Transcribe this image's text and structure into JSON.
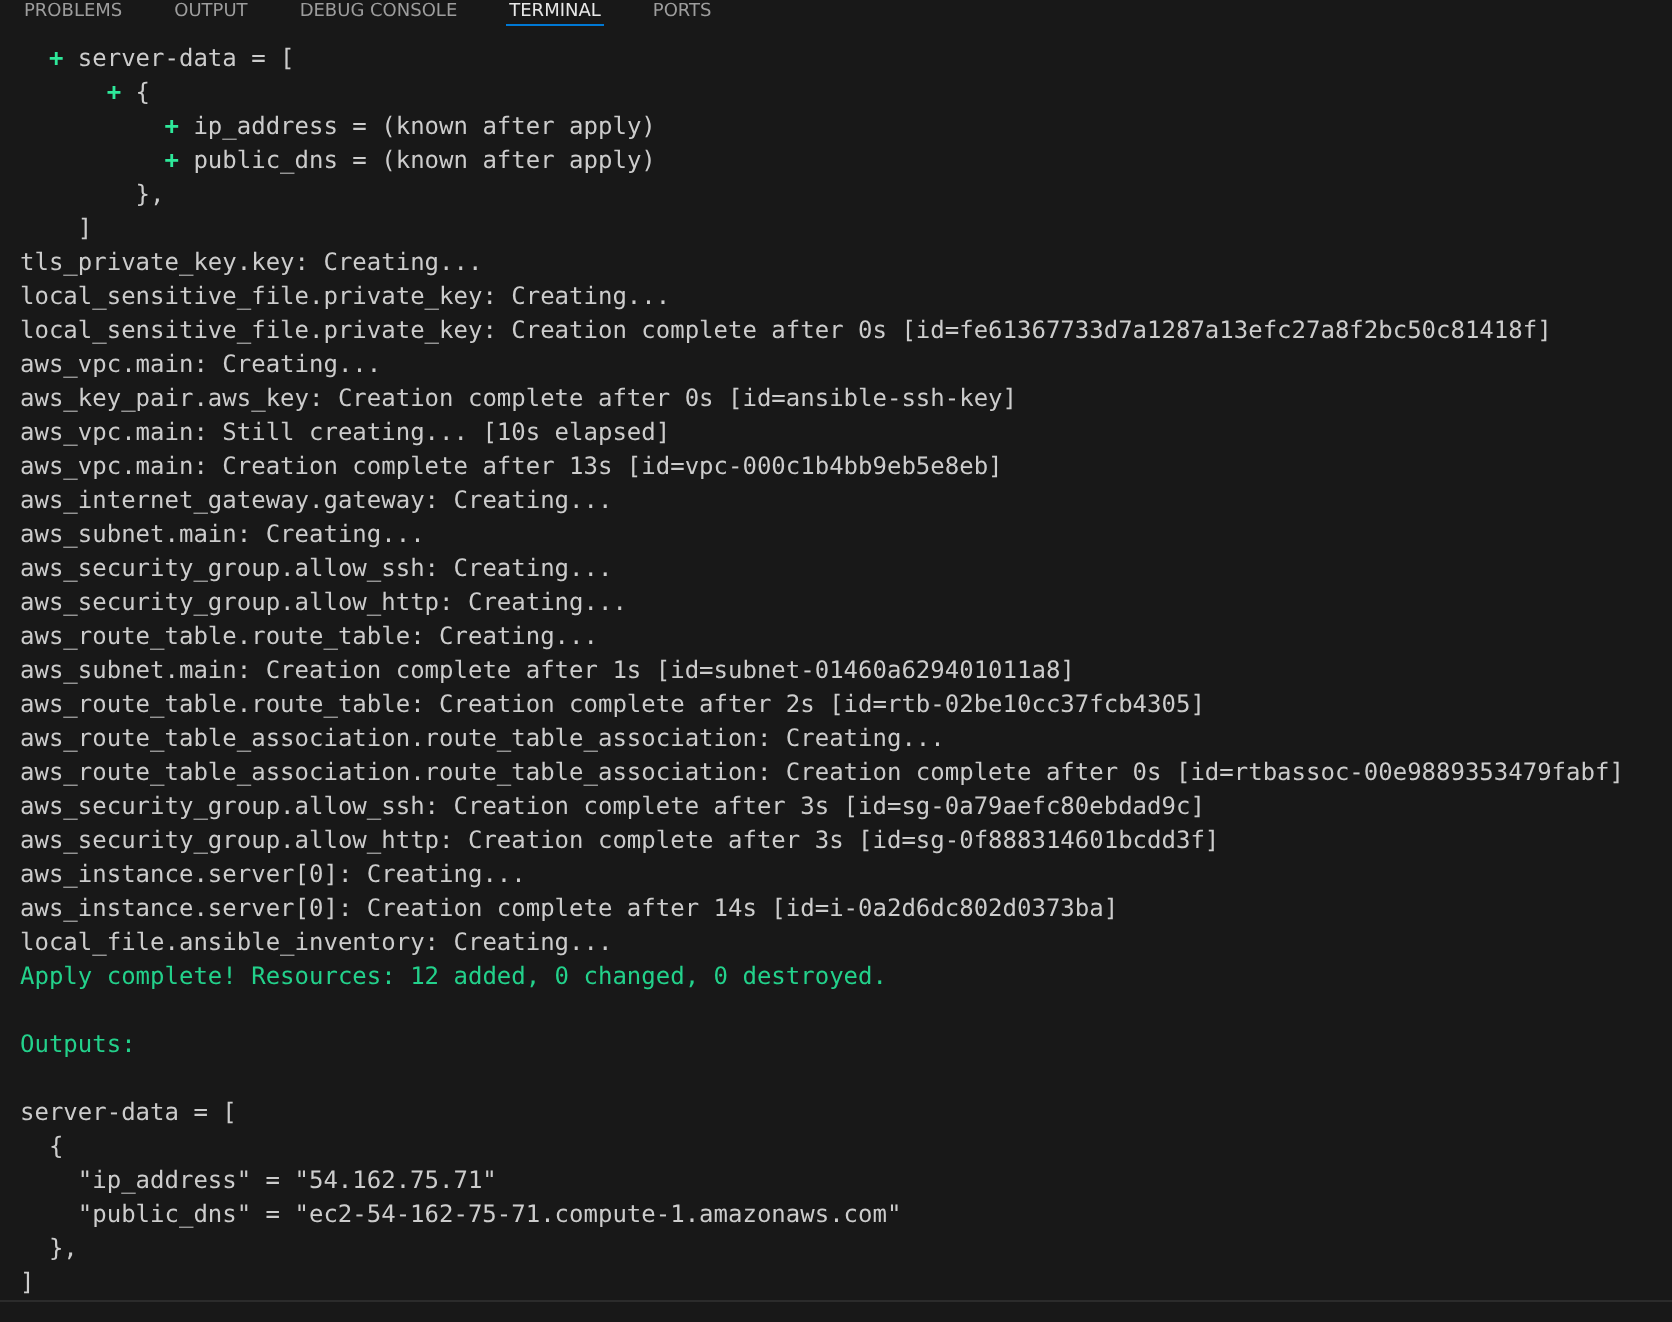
{
  "tabs": [
    {
      "label": "PROBLEMS",
      "selected": false
    },
    {
      "label": "OUTPUT",
      "selected": false
    },
    {
      "label": "DEBUG CONSOLE",
      "selected": false
    },
    {
      "label": "TERMINAL",
      "selected": true
    },
    {
      "label": "PORTS",
      "selected": false
    }
  ],
  "plan": [
    {
      "kind": "added",
      "sign": "+",
      "text": "server-data = [",
      "children": [
        {
          "kind": "added",
          "sign": "+",
          "text": "{",
          "children": [
            {
              "kind": "added",
              "sign": "+",
              "text": "ip_address = (known after apply)"
            },
            {
              "kind": "added",
              "sign": "+",
              "text": "public_dns = (known after apply)"
            }
          ]
        },
        {
          "kind": "plain",
          "text": "},"
        }
      ]
    },
    {
      "kind": "plain",
      "text": "]"
    }
  ],
  "log": [
    {
      "kind": "plain",
      "text": "tls_private_key.key: Creating..."
    },
    {
      "kind": "plain",
      "text": "local_sensitive_file.private_key: Creating..."
    },
    {
      "kind": "plain",
      "text": "local_sensitive_file.private_key: Creation complete after 0s [id=fe61367733d7a1287a13efc27a8f2bc50c81418f]"
    },
    {
      "kind": "plain",
      "text": "aws_vpc.main: Creating..."
    },
    {
      "kind": "plain",
      "text": "aws_key_pair.aws_key: Creation complete after 0s [id=ansible-ssh-key]"
    },
    {
      "kind": "plain",
      "text": "aws_vpc.main: Still creating... [10s elapsed]"
    },
    {
      "kind": "plain",
      "text": "aws_vpc.main: Creation complete after 13s [id=vpc-000c1b4bb9eb5e8eb]"
    },
    {
      "kind": "plain",
      "text": "aws_internet_gateway.gateway: Creating..."
    },
    {
      "kind": "plain",
      "text": "aws_subnet.main: Creating..."
    },
    {
      "kind": "plain",
      "text": "aws_security_group.allow_ssh: Creating..."
    },
    {
      "kind": "plain",
      "text": "aws_security_group.allow_http: Creating..."
    },
    {
      "kind": "plain",
      "text": "aws_route_table.route_table: Creating..."
    },
    {
      "kind": "plain",
      "text": "aws_subnet.main: Creation complete after 1s [id=subnet-01460a629401011a8]"
    },
    {
      "kind": "plain",
      "text": "aws_route_table.route_table: Creation complete after 2s [id=rtb-02be10cc37fcb4305]"
    },
    {
      "kind": "plain",
      "text": "aws_route_table_association.route_table_association: Creating..."
    },
    {
      "kind": "plain",
      "text": "aws_route_table_association.route_table_association: Creation complete after 0s [id=rtbassoc-00e9889353479fabf]"
    },
    {
      "kind": "plain",
      "text": "aws_security_group.allow_ssh: Creation complete after 3s [id=sg-0a79aefc80ebdad9c]"
    },
    {
      "kind": "plain",
      "text": "aws_security_group.allow_http: Creation complete after 3s [id=sg-0f888314601bcdd3f]"
    },
    {
      "kind": "plain",
      "text": "aws_instance.server[0]: Creating..."
    },
    {
      "kind": "plain",
      "text": "aws_instance.server[0]: Creation complete after 14s [id=i-0a2d6dc802d0373ba]"
    },
    {
      "kind": "plain",
      "text": "local_file.ansible_inventory: Creating..."
    },
    {
      "kind": "success",
      "text": "Apply complete! Resources: 12 added, 0 changed, 0 destroyed."
    }
  ],
  "outputs": {
    "heading": "Outputs:",
    "lines": [
      {
        "text": "server-data = [",
        "children": [
          {
            "text": "{",
            "children": [
              {
                "text": "\"ip_address\" = \"54.162.75.71\""
              },
              {
                "text": "\"public_dns\" = \"ec2-54-162-75-71.compute-1.amazonaws.com\""
              }
            ]
          },
          {
            "text": "},"
          }
        ]
      },
      {
        "text": "]"
      }
    ]
  }
}
